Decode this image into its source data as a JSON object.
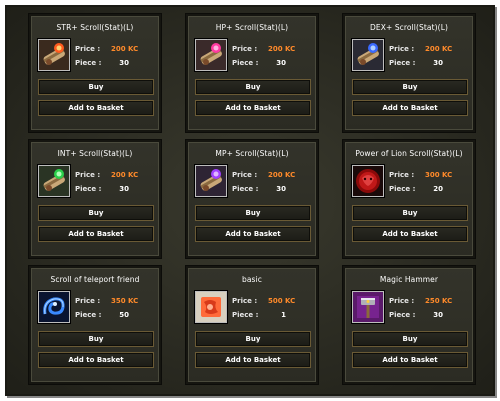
{
  "items": [
    {
      "title": "STR+ Scroll(Stat)(L)",
      "price_label": "Price :",
      "price": "200 KC",
      "piece_label": "Piece :",
      "piece": "30",
      "buy_label": "Buy",
      "basket_label": "Add to Basket",
      "icon": "scroll-orange-icon"
    },
    {
      "title": "HP+ Scroll(Stat)(L)",
      "price_label": "Price :",
      "price": "200 KC",
      "piece_label": "Piece :",
      "piece": "30",
      "buy_label": "Buy",
      "basket_label": "Add to Basket",
      "icon": "scroll-pink-icon"
    },
    {
      "title": "DEX+ Scroll(Stat)(L)",
      "price_label": "Price :",
      "price": "200 KC",
      "piece_label": "Piece :",
      "piece": "30",
      "buy_label": "Buy",
      "basket_label": "Add to Basket",
      "icon": "scroll-blue-icon"
    },
    {
      "title": "INT+ Scroll(Stat)(L)",
      "price_label": "Price :",
      "price": "200 KC",
      "piece_label": "Piece :",
      "piece": "30",
      "buy_label": "Buy",
      "basket_label": "Add to Basket",
      "icon": "scroll-green-icon"
    },
    {
      "title": "MP+ Scroll(Stat)(L)",
      "price_label": "Price :",
      "price": "200 KC",
      "piece_label": "Piece :",
      "piece": "30",
      "buy_label": "Buy",
      "basket_label": "Add to Basket",
      "icon": "scroll-purple-icon"
    },
    {
      "title": "Power of Lion Scroll(Stat)(L)",
      "price_label": "Price :",
      "price": "300 KC",
      "piece_label": "Piece :",
      "piece": "20",
      "buy_label": "Buy",
      "basket_label": "Add to Basket",
      "icon": "lion-orb-icon"
    },
    {
      "title": "Scroll of teleport friend",
      "price_label": "Price :",
      "price": "350 KC",
      "piece_label": "Piece :",
      "piece": "50",
      "buy_label": "Buy",
      "basket_label": "Add to Basket",
      "icon": "teleport-swirl-icon"
    },
    {
      "title": "basic",
      "price_label": "Price :",
      "price": "500 KC",
      "piece_label": "Piece :",
      "piece": "1",
      "buy_label": "Buy",
      "basket_label": "Add to Basket",
      "icon": "basic-parchment-icon"
    },
    {
      "title": "Magic Hammer",
      "price_label": "Price :",
      "price": "250 KC",
      "piece_label": "Piece :",
      "piece": "30",
      "buy_label": "Buy",
      "basket_label": "Add to Basket",
      "icon": "magic-hammer-icon"
    }
  ],
  "colors": {
    "price": "#ff8a2a",
    "text": "#ffffff",
    "button_border": "#6a5a35"
  }
}
